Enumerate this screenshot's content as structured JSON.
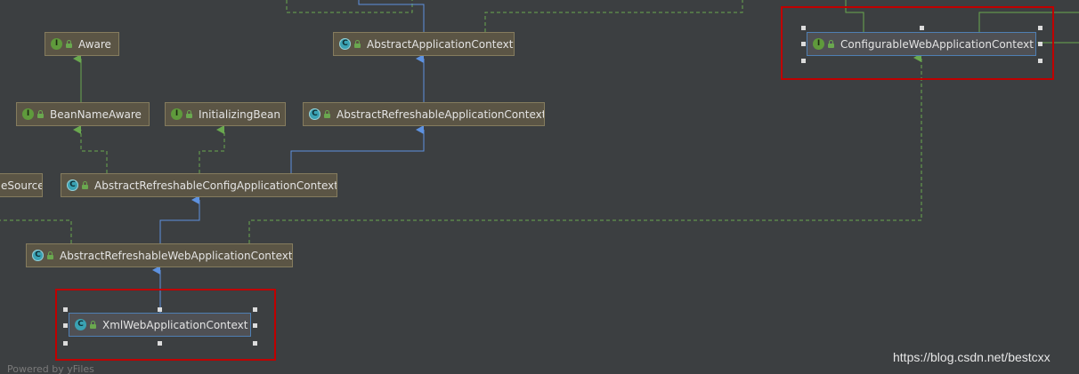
{
  "diagram": {
    "nodes": {
      "aware": {
        "badge": "I",
        "label": "Aware"
      },
      "abstract_app_ctx": {
        "badge": "C",
        "label": "AbstractApplicationContext"
      },
      "configurable_web_app_ctx": {
        "badge": "I",
        "label": "ConfigurableWebApplicationContext"
      },
      "bean_name_aware": {
        "badge": "I",
        "label": "BeanNameAware"
      },
      "initializing_bean": {
        "badge": "I",
        "label": "InitializingBean"
      },
      "abstract_refreshable_app_ctx": {
        "badge": "C",
        "label": "AbstractRefreshableApplicationContext"
      },
      "resource_partial": {
        "label": "eSource"
      },
      "abstract_refreshable_config_app_ctx": {
        "badge": "C",
        "label": "AbstractRefreshableConfigApplicationContext"
      },
      "abstract_refreshable_web_app_ctx": {
        "badge": "C",
        "label": "AbstractRefreshableWebApplicationContext"
      },
      "xml_web_app_ctx": {
        "badge": "C",
        "label": "XmlWebApplicationContext"
      }
    },
    "colors": {
      "background": "#3c3f41",
      "node_fill": "#5b5545",
      "extends_edge": "#5e92e0",
      "implements_edge": "#6aa84f",
      "highlight": "#c00000"
    }
  },
  "footer": {
    "credit": "Powered by yFiles",
    "watermark": "https://blog.csdn.net/bestcxx"
  }
}
